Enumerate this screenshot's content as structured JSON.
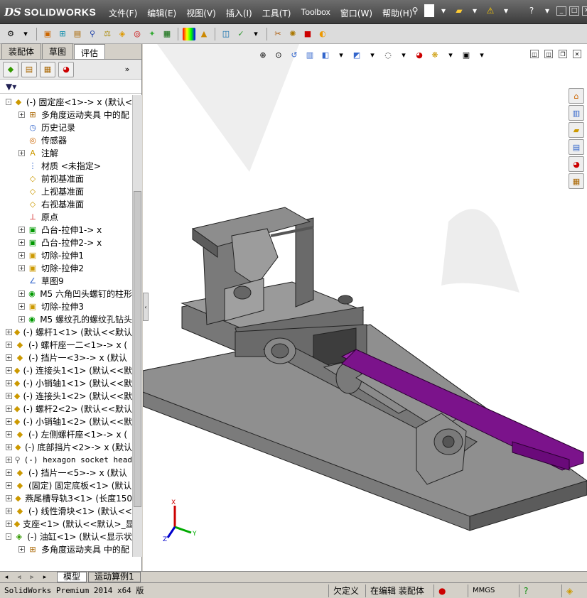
{
  "app": {
    "logo_ds": "DS",
    "logo_text": "SOLIDWORKS"
  },
  "menu": [
    "文件(F)",
    "编辑(E)",
    "视图(V)",
    "插入(I)",
    "工具(T)",
    "Toolbox",
    "窗口(W)",
    "帮助(H)"
  ],
  "tabs": [
    "装配体",
    "草图",
    "评估"
  ],
  "tree": [
    {
      "label": "(-) 固定座<1>-> x (默认<",
      "level": 0,
      "exp": "-",
      "icon": "part-icon"
    },
    {
      "label": "多角度运动夹具 中的配",
      "level": 1,
      "exp": "+",
      "icon": "mates-icon"
    },
    {
      "label": "历史记录",
      "level": 1,
      "exp": "",
      "icon": "history-icon"
    },
    {
      "label": "传感器",
      "level": 1,
      "exp": "",
      "icon": "sensor-icon"
    },
    {
      "label": "注解",
      "level": 1,
      "exp": "+",
      "icon": "annotation-icon"
    },
    {
      "label": "材质 <未指定>",
      "level": 1,
      "exp": "",
      "icon": "material-icon"
    },
    {
      "label": "前视基准面",
      "level": 1,
      "exp": "",
      "icon": "plane-icon"
    },
    {
      "label": "上视基准面",
      "level": 1,
      "exp": "",
      "icon": "plane-icon"
    },
    {
      "label": "右视基准面",
      "level": 1,
      "exp": "",
      "icon": "plane-icon"
    },
    {
      "label": "原点",
      "level": 1,
      "exp": "",
      "icon": "origin-icon"
    },
    {
      "label": "凸台-拉伸1-> x",
      "level": 1,
      "exp": "+",
      "icon": "extrude-icon"
    },
    {
      "label": "凸台-拉伸2-> x",
      "level": 1,
      "exp": "+",
      "icon": "extrude-icon"
    },
    {
      "label": "切除-拉伸1",
      "level": 1,
      "exp": "+",
      "icon": "cut-icon"
    },
    {
      "label": "切除-拉伸2",
      "level": 1,
      "exp": "+",
      "icon": "cut-icon"
    },
    {
      "label": "草图9",
      "level": 1,
      "exp": "",
      "icon": "sketch-icon"
    },
    {
      "label": "M5 六角凹头螺钉的柱形",
      "level": 1,
      "exp": "+",
      "icon": "hole-icon"
    },
    {
      "label": "切除-拉伸3",
      "level": 1,
      "exp": "+",
      "icon": "cut-icon"
    },
    {
      "label": "M5 螺纹孔的螺纹孔钻头",
      "level": 1,
      "exp": "+",
      "icon": "hole-icon"
    },
    {
      "label": "(-) 螺杆1<1> (默认<<默认",
      "level": 0,
      "exp": "+",
      "icon": "part-icon"
    },
    {
      "label": "(-) 螺杆座一二<1>-> x (",
      "level": 0,
      "exp": "+",
      "icon": "part-icon"
    },
    {
      "label": "(-) 挡片一<3>-> x (默认",
      "level": 0,
      "exp": "+",
      "icon": "part-icon"
    },
    {
      "label": "(-) 连接头1<1> (默认<<默",
      "level": 0,
      "exp": "+",
      "icon": "part-icon"
    },
    {
      "label": "(-) 小销轴1<1> (默认<<默",
      "level": 0,
      "exp": "+",
      "icon": "part-icon"
    },
    {
      "label": "(-) 连接头1<2> (默认<<默",
      "level": 0,
      "exp": "+",
      "icon": "part-icon"
    },
    {
      "label": "(-) 螺杆2<2> (默认<<默认",
      "level": 0,
      "exp": "+",
      "icon": "part-icon"
    },
    {
      "label": "(-) 小销轴1<2> (默认<<默",
      "level": 0,
      "exp": "+",
      "icon": "part-icon"
    },
    {
      "label": "(-) 左侧螺杆座<1>-> x (",
      "level": 0,
      "exp": "+",
      "icon": "part-icon"
    },
    {
      "label": "(-) 底部挡片<2>-> x (默认",
      "level": 0,
      "exp": "+",
      "icon": "part-icon"
    },
    {
      "label": "(-) hexagon socket head",
      "level": 0,
      "exp": "+",
      "icon": "toolbox-icon",
      "mono": true
    },
    {
      "label": "(-) 挡片一<5>-> x (默认",
      "level": 0,
      "exp": "+",
      "icon": "part-icon"
    },
    {
      "label": "(固定) 固定底板<1> (默认",
      "level": 0,
      "exp": "+",
      "icon": "part-icon"
    },
    {
      "label": "燕尾槽导轨3<1> (长度150",
      "level": 0,
      "exp": "+",
      "icon": "part-icon"
    },
    {
      "label": "(-) 线性滑块<1> (默认<<",
      "level": 0,
      "exp": "+",
      "icon": "part-icon"
    },
    {
      "label": "支座<1> (默认<<默认>_显",
      "level": 0,
      "exp": "+",
      "icon": "part-icon"
    },
    {
      "label": "(-) 油缸<1> (默认<显示状",
      "level": 0,
      "exp": "-",
      "icon": "assembly-icon"
    },
    {
      "label": "多角度运动夹具 中的配",
      "level": 1,
      "exp": "+",
      "icon": "mates-icon"
    }
  ],
  "bottom_tabs": [
    "模型",
    "运动算例1"
  ],
  "status": {
    "product": "SolidWorks Premium 2014 x64 版",
    "state1": "欠定义",
    "state2": "在编辑 装配体",
    "units": "MMGS"
  },
  "triad": {
    "x": "X",
    "y": "Y",
    "z": "Z"
  },
  "colors": {
    "rail": "#8a1a9a",
    "metal": "#8c8c8c",
    "titlebar": "#4a4a4a"
  }
}
